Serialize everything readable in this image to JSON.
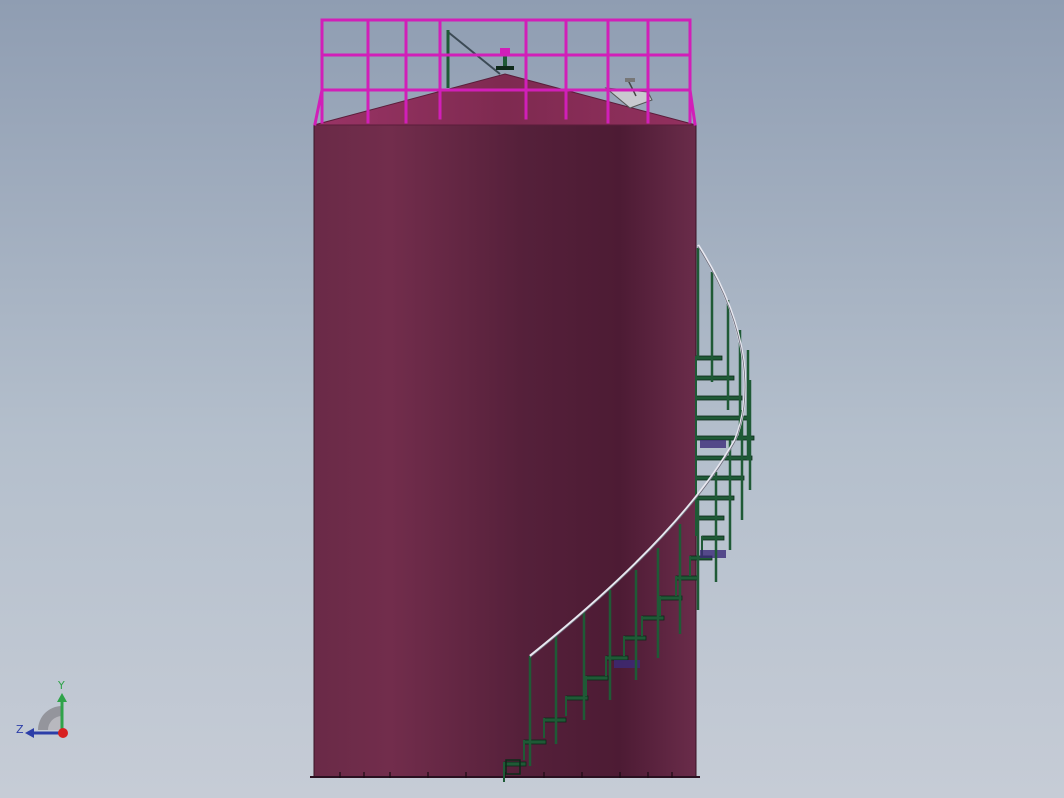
{
  "viewport": {
    "background_top": "#8f9db2",
    "background_bottom": "#c6ccd6"
  },
  "colors": {
    "tank_shell": "#6b2a48",
    "tank_roof": "#8a2c58",
    "roof_handrail": "#d11fb8",
    "stair_frame": "#1f5a36",
    "stair_handrail": "#e8e8f0",
    "stair_tread_shadow": "#3b2a78",
    "axis_x": "#d82020",
    "axis_y": "#2fa34a",
    "axis_z": "#2c3ea8"
  },
  "model": {
    "parts": [
      "tank-shell",
      "cone-roof",
      "roof-handrail",
      "spiral-staircase",
      "stair-handrail",
      "roof-vent",
      "roof-nozzle"
    ]
  },
  "triad": {
    "y_label": "Y",
    "z_label": "Z"
  }
}
